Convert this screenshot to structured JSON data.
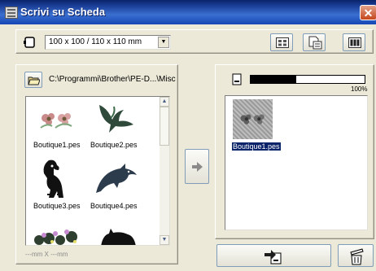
{
  "window": {
    "title": "Scrivi su Scheda",
    "close_glyph": "✕"
  },
  "toolbar": {
    "hoop_select_value": "100 x 100 / 110 x 110 mm",
    "icons": [
      "hoop-icon",
      "grid-view-icon",
      "document-list-icon",
      "card-icon"
    ]
  },
  "source": {
    "path": "C:\\Programmi\\Brother\\PE-D...\\Misc",
    "files": [
      {
        "name": "Boutique1.pes",
        "icon": "flowers-design-icon"
      },
      {
        "name": "Boutique2.pes",
        "icon": "bird-design-icon"
      },
      {
        "name": "Boutique3.pes",
        "icon": "dog-design-icon"
      },
      {
        "name": "Boutique4.pes",
        "icon": "dolphin-design-icon"
      },
      {
        "name": "",
        "icon": "flowers-border-design-icon"
      },
      {
        "name": "",
        "icon": "cat-design-icon"
      }
    ],
    "size_status": "---mm X ---mm"
  },
  "target": {
    "progress_percent_label": "100%",
    "progress_value": 0.4,
    "files": [
      {
        "name": "Boutique1.pes",
        "selected": true
      }
    ]
  },
  "actions": {
    "transfer_icon": "arrow-right-icon",
    "write_icon": "write-to-card-icon",
    "recycle_icon": "recycle-bin-icon"
  },
  "colors": {
    "title_bar": "#1c3f98",
    "selection": "#0a246a",
    "face": "#ece9d8"
  }
}
